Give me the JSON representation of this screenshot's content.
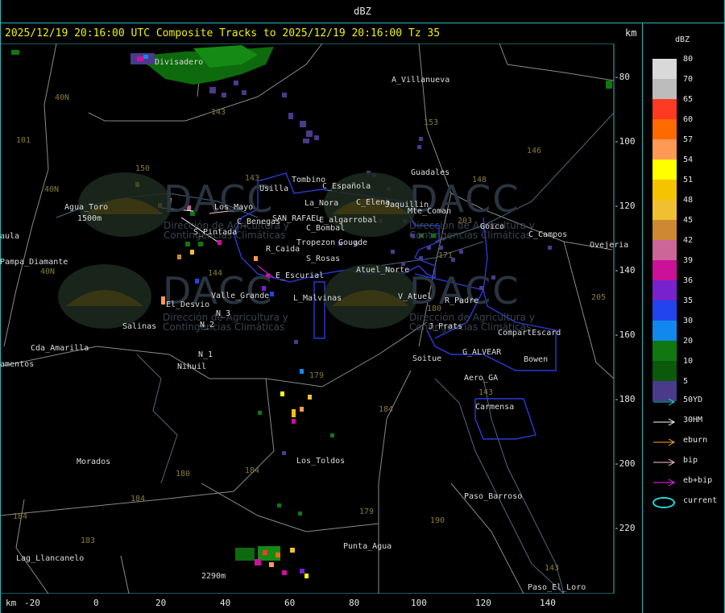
{
  "window": {
    "title": "dBZ"
  },
  "header": {
    "text": "2025/12/19 20:16:00 UTC Composite Tracks to 2025/12/19 20:16:00 Tz 35",
    "km_unit": "km"
  },
  "axes": {
    "y_ticks": [
      "-80",
      "-100",
      "-120",
      "-140",
      "-160",
      "-180",
      "-200",
      "-220"
    ],
    "x_ticks": [
      "-20",
      "0",
      "20",
      "40",
      "60",
      "80",
      "100",
      "120",
      "140"
    ],
    "x_unit": "km"
  },
  "legend": {
    "title": "dBZ",
    "levels": [
      {
        "label": "80",
        "color": "#d9d9d9"
      },
      {
        "label": "70",
        "color": "#bcbcbc"
      },
      {
        "label": "65",
        "color": "#ff3a22"
      },
      {
        "label": "60",
        "color": "#ff6a00"
      },
      {
        "label": "57",
        "color": "#ff9955"
      },
      {
        "label": "54",
        "color": "#ffff00"
      },
      {
        "label": "51",
        "color": "#f5c400"
      },
      {
        "label": "48",
        "color": "#f0c030"
      },
      {
        "label": "45",
        "color": "#cc8833"
      },
      {
        "label": "42",
        "color": "#cc6699"
      },
      {
        "label": "39",
        "color": "#cc1199"
      },
      {
        "label": "36",
        "color": "#7722cc"
      },
      {
        "label": "35",
        "color": "#2244ee"
      },
      {
        "label": "30",
        "color": "#1188ee"
      },
      {
        "label": "20",
        "color": "#117711"
      },
      {
        "label": "10",
        "color": "#0a5a0a"
      },
      {
        "label": "5",
        "color": "#4a3a8a"
      }
    ],
    "tracks": [
      {
        "label": "50YD",
        "color": "#22d4d4"
      },
      {
        "label": "30HM",
        "color": "#ffffff"
      },
      {
        "label": "eburn",
        "color": "#ffaa22"
      },
      {
        "label": "bip",
        "color": "#ffcccc"
      },
      {
        "label": "eb+bip",
        "color": "#ff22ff"
      },
      {
        "label": "current",
        "color": "#22d4d4"
      }
    ]
  },
  "places": [
    {
      "name": "Divisadero"
    },
    {
      "name": "A_Villanueva"
    },
    {
      "name": "Guadales"
    },
    {
      "name": "C_Española"
    },
    {
      "name": "Usilla"
    },
    {
      "name": "Tombino"
    },
    {
      "name": "C_Elena"
    },
    {
      "name": "Jaquillin"
    },
    {
      "name": "Agua_Toro"
    },
    {
      "name": "1500m"
    },
    {
      "name": "Los_Mayo"
    },
    {
      "name": "Goico"
    },
    {
      "name": "C_Campos"
    },
    {
      "name": "Ovejeria"
    },
    {
      "name": "Pampa_Diamante"
    },
    {
      "name": "La_Nora"
    },
    {
      "name": "C_Benegas"
    },
    {
      "name": "SAN_RAFAEL"
    },
    {
      "name": "C_Bombal"
    },
    {
      "name": "E_algarrobal"
    },
    {
      "name": "S_Pintada"
    },
    {
      "name": "R_Caida"
    },
    {
      "name": "Tropezon"
    },
    {
      "name": "Gougde"
    },
    {
      "name": "S_Rosas"
    },
    {
      "name": "E_Escurial"
    },
    {
      "name": "Atuel_Norte"
    },
    {
      "name": "Valle_Grande"
    },
    {
      "name": "L_Malvinas"
    },
    {
      "name": "V_Atuel"
    },
    {
      "name": "R_Padre"
    },
    {
      "name": "El_Desvio"
    },
    {
      "name": "Salinas"
    },
    {
      "name": "N_2"
    },
    {
      "name": "N_3"
    },
    {
      "name": "N_1"
    },
    {
      "name": "Nihuil"
    },
    {
      "name": "Cda_Amarilla"
    },
    {
      "name": "amentos"
    },
    {
      "name": "J_Prats"
    },
    {
      "name": "CompartEscard"
    },
    {
      "name": "G_ALVEAR"
    },
    {
      "name": "Soitue"
    },
    {
      "name": "Bowen"
    },
    {
      "name": "Aero_GA"
    },
    {
      "name": "Carmensa"
    },
    {
      "name": "Morados"
    },
    {
      "name": "Los_Toldos"
    },
    {
      "name": "Paso_Barroso"
    },
    {
      "name": "Lag_Llancanelo"
    },
    {
      "name": "Punta_Agua"
    },
    {
      "name": "2290m"
    },
    {
      "name": "Paso_El_Loro"
    },
    {
      "name": "Mte_Coman"
    },
    {
      "name": "aula"
    }
  ],
  "roads": [
    "143",
    "153",
    "146",
    "150",
    "148",
    "40N",
    "40N",
    "101",
    "143",
    "203",
    "171",
    "144",
    "40N",
    "180",
    "184",
    "179",
    "184",
    "183",
    "184",
    "180",
    "190",
    "179",
    "143",
    "143",
    "205",
    "184"
  ],
  "watermarks": [
    {
      "text": "DACC"
    },
    {
      "text": "DACC"
    },
    {
      "text": "DACC"
    },
    {
      "text": "DACC"
    }
  ],
  "watermark_sub": "Dirección de Agricultura y Contingencias Climáticas",
  "chart_data": {
    "type": "map",
    "title": "2025/12/19 20:16:00 UTC Composite Tracks to 2025/12/19 20:16:00 Tz 35",
    "xlabel": "km",
    "ylabel": "km",
    "xlim": [
      -20,
      140
    ],
    "ylim": [
      -80,
      -220
    ]
  }
}
